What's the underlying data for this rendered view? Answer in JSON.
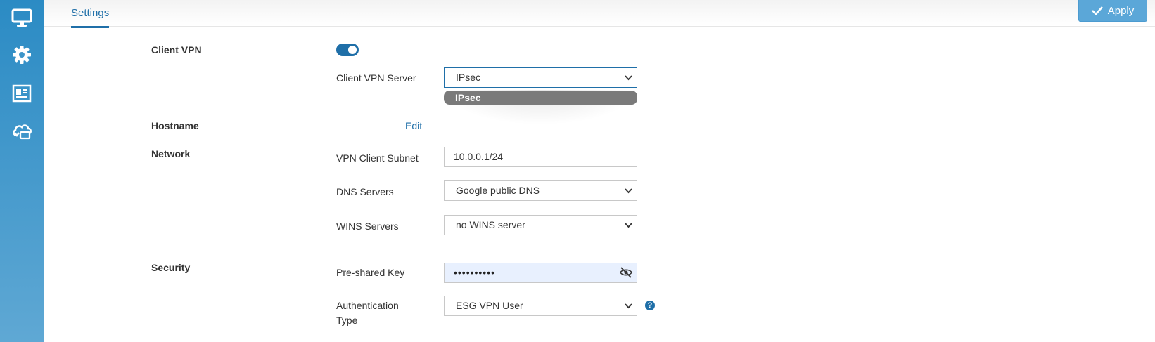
{
  "header": {
    "tab_label": "Settings",
    "apply_label": "Apply"
  },
  "sidebar": {
    "icons": [
      "monitor-icon",
      "gear-icon",
      "newspaper-icon",
      "cloud-sync-icon"
    ]
  },
  "client_vpn": {
    "section": "Client VPN",
    "enabled": true,
    "server_label": "Client VPN Server",
    "server_value": "IPsec",
    "server_options": [
      "IPsec"
    ]
  },
  "hostname": {
    "section": "Hostname",
    "edit_label": "Edit"
  },
  "network": {
    "section": "Network",
    "subnet_label": "VPN Client Subnet",
    "subnet_value": "10.0.0.1/24",
    "dns_label": "DNS Servers",
    "dns_value": "Google public DNS",
    "wins_label": "WINS Servers",
    "wins_value": "no WINS server"
  },
  "security": {
    "section": "Security",
    "psk_label": "Pre-shared Key",
    "psk_value": "••••••••••",
    "auth_label_line1": "Authentication",
    "auth_label_line2": "Type",
    "auth_value": "ESG VPN User",
    "help_glyph": "?"
  },
  "colors": {
    "accent": "#1f6fa8",
    "apply_bg": "#5ba7d8",
    "sidebar_top": "#2b8bc4",
    "sidebar_bottom": "#5fa8d4",
    "autofill_bg": "#e8f0fe"
  }
}
